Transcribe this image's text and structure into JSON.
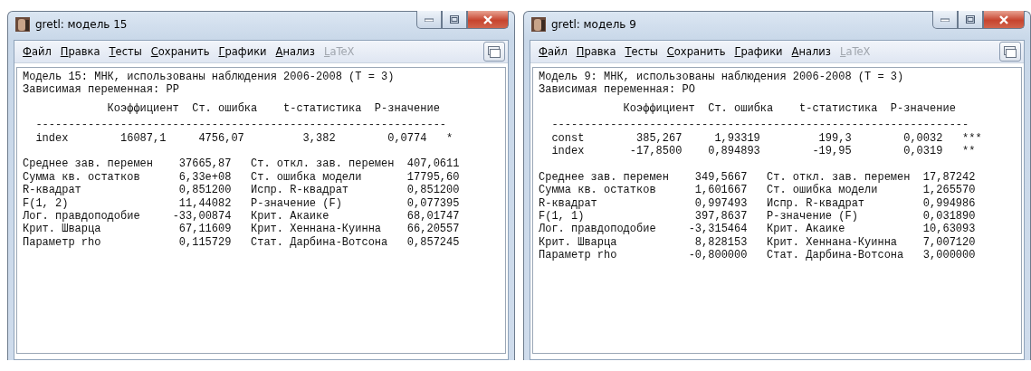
{
  "windows": [
    {
      "title": "gretl: модель 15",
      "menu": [
        {
          "label": "Файл",
          "disabled": false
        },
        {
          "label": "Правка",
          "disabled": false
        },
        {
          "label": "Тесты",
          "disabled": false
        },
        {
          "label": "Сохранить",
          "disabled": false
        },
        {
          "label": "Графики",
          "disabled": false
        },
        {
          "label": "Анализ",
          "disabled": false
        },
        {
          "label": "LaTeX",
          "disabled": true
        }
      ],
      "header_lines": [
        "Модель 15: МНК, использованы наблюдения 2006-2008 (T = 3)",
        "Зависимая переменная: PP"
      ],
      "columns": [
        "Коэффициент",
        "Ст. ошибка",
        "t-статистика",
        "P-значение"
      ],
      "separator": "---------------------------------------------------------------",
      "coefficients": [
        {
          "name": "index",
          "coef": "16087,1",
          "se": "4756,07",
          "t": "3,382",
          "p": "0,0774",
          "stars": "*"
        }
      ],
      "stats": [
        {
          "label": "Среднее зав. перемен",
          "value": "37665,87",
          "label2": "Ст. откл. зав. перемен",
          "value2": "407,0611"
        },
        {
          "label": "Сумма кв. остатков",
          "value": "6,33e+08",
          "label2": "Ст. ошибка модели",
          "value2": "17795,60"
        },
        {
          "label": "R-квадрат",
          "value": "0,851200",
          "label2": "Испр. R-квадрат",
          "value2": "0,851200"
        },
        {
          "label": "F(1, 2)",
          "value": "11,44082",
          "label2": "P-значение (F)",
          "value2": "0,077395"
        },
        {
          "label": "Лог. правдоподобие",
          "value": "-33,00874",
          "label2": "Крит. Акаике",
          "value2": "68,01747"
        },
        {
          "label": "Крит. Шварца",
          "value": "67,11609",
          "label2": "Крит. Хеннана-Куинна",
          "value2": "66,20557"
        },
        {
          "label": "Параметр rho",
          "value": "0,115729",
          "label2": "Стат. Дарбина-Вотсона",
          "value2": "0,857245"
        }
      ]
    },
    {
      "title": "gretl: модель 9",
      "menu": [
        {
          "label": "Файл",
          "disabled": false
        },
        {
          "label": "Правка",
          "disabled": false
        },
        {
          "label": "Тесты",
          "disabled": false
        },
        {
          "label": "Сохранить",
          "disabled": false
        },
        {
          "label": "Графики",
          "disabled": false
        },
        {
          "label": "Анализ",
          "disabled": false
        },
        {
          "label": "LaTeX",
          "disabled": true
        }
      ],
      "header_lines": [
        "Модель 9: МНК, использованы наблюдения 2006-2008 (T = 3)",
        "Зависимая переменная: PO"
      ],
      "columns": [
        "Коэффициент",
        "Ст. ошибка",
        "t-статистика",
        "P-значение"
      ],
      "separator": "----------------------------------------------------------------",
      "coefficients": [
        {
          "name": "const",
          "coef": "385,267",
          "se": "1,93319",
          "t": "199,3",
          "p": "0,0032",
          "stars": "***"
        },
        {
          "name": "index",
          "coef": "-17,8500",
          "se": "0,894893",
          "t": "-19,95",
          "p": "0,0319",
          "stars": "**"
        }
      ],
      "stats": [
        {
          "label": "Среднее зав. перемен",
          "value": "349,5667",
          "label2": "Ст. откл. зав. перемен",
          "value2": "17,87242"
        },
        {
          "label": "Сумма кв. остатков",
          "value": "1,601667",
          "label2": "Ст. ошибка модели",
          "value2": "1,265570"
        },
        {
          "label": "R-квадрат",
          "value": "0,997493",
          "label2": "Испр. R-квадрат",
          "value2": "0,994986"
        },
        {
          "label": "F(1, 1)",
          "value": "397,8637",
          "label2": "P-значение (F)",
          "value2": "0,031890"
        },
        {
          "label": "Лог. правдоподобие",
          "value": "-3,315464",
          "label2": "Крит. Акаике",
          "value2": "10,63093"
        },
        {
          "label": "Крит. Шварца",
          "value": "8,828153",
          "label2": "Крит. Хеннана-Куинна",
          "value2": "7,007120"
        },
        {
          "label": "Параметр rho",
          "value": "-0,800000",
          "label2": "Стат. Дарбина-Вотсона",
          "value2": "3,000000"
        }
      ]
    }
  ]
}
